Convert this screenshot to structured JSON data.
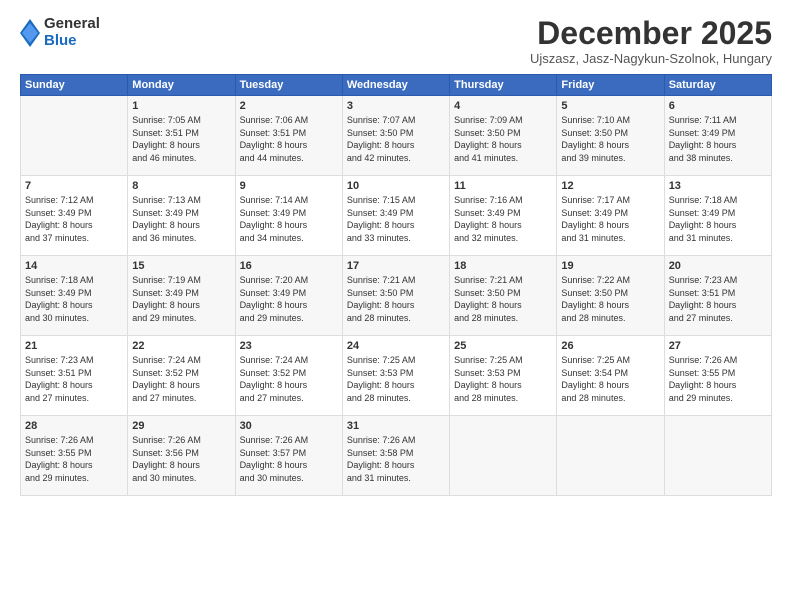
{
  "logo": {
    "general": "General",
    "blue": "Blue"
  },
  "title": "December 2025",
  "subtitle": "Ujszasz, Jasz-Nagykun-Szolnok, Hungary",
  "headers": [
    "Sunday",
    "Monday",
    "Tuesday",
    "Wednesday",
    "Thursday",
    "Friday",
    "Saturday"
  ],
  "weeks": [
    [
      {
        "day": "",
        "info": ""
      },
      {
        "day": "1",
        "info": "Sunrise: 7:05 AM\nSunset: 3:51 PM\nDaylight: 8 hours\nand 46 minutes."
      },
      {
        "day": "2",
        "info": "Sunrise: 7:06 AM\nSunset: 3:51 PM\nDaylight: 8 hours\nand 44 minutes."
      },
      {
        "day": "3",
        "info": "Sunrise: 7:07 AM\nSunset: 3:50 PM\nDaylight: 8 hours\nand 42 minutes."
      },
      {
        "day": "4",
        "info": "Sunrise: 7:09 AM\nSunset: 3:50 PM\nDaylight: 8 hours\nand 41 minutes."
      },
      {
        "day": "5",
        "info": "Sunrise: 7:10 AM\nSunset: 3:50 PM\nDaylight: 8 hours\nand 39 minutes."
      },
      {
        "day": "6",
        "info": "Sunrise: 7:11 AM\nSunset: 3:49 PM\nDaylight: 8 hours\nand 38 minutes."
      }
    ],
    [
      {
        "day": "7",
        "info": "Sunrise: 7:12 AM\nSunset: 3:49 PM\nDaylight: 8 hours\nand 37 minutes."
      },
      {
        "day": "8",
        "info": "Sunrise: 7:13 AM\nSunset: 3:49 PM\nDaylight: 8 hours\nand 36 minutes."
      },
      {
        "day": "9",
        "info": "Sunrise: 7:14 AM\nSunset: 3:49 PM\nDaylight: 8 hours\nand 34 minutes."
      },
      {
        "day": "10",
        "info": "Sunrise: 7:15 AM\nSunset: 3:49 PM\nDaylight: 8 hours\nand 33 minutes."
      },
      {
        "day": "11",
        "info": "Sunrise: 7:16 AM\nSunset: 3:49 PM\nDaylight: 8 hours\nand 32 minutes."
      },
      {
        "day": "12",
        "info": "Sunrise: 7:17 AM\nSunset: 3:49 PM\nDaylight: 8 hours\nand 31 minutes."
      },
      {
        "day": "13",
        "info": "Sunrise: 7:18 AM\nSunset: 3:49 PM\nDaylight: 8 hours\nand 31 minutes."
      }
    ],
    [
      {
        "day": "14",
        "info": "Sunrise: 7:18 AM\nSunset: 3:49 PM\nDaylight: 8 hours\nand 30 minutes."
      },
      {
        "day": "15",
        "info": "Sunrise: 7:19 AM\nSunset: 3:49 PM\nDaylight: 8 hours\nand 29 minutes."
      },
      {
        "day": "16",
        "info": "Sunrise: 7:20 AM\nSunset: 3:49 PM\nDaylight: 8 hours\nand 29 minutes."
      },
      {
        "day": "17",
        "info": "Sunrise: 7:21 AM\nSunset: 3:50 PM\nDaylight: 8 hours\nand 28 minutes."
      },
      {
        "day": "18",
        "info": "Sunrise: 7:21 AM\nSunset: 3:50 PM\nDaylight: 8 hours\nand 28 minutes."
      },
      {
        "day": "19",
        "info": "Sunrise: 7:22 AM\nSunset: 3:50 PM\nDaylight: 8 hours\nand 28 minutes."
      },
      {
        "day": "20",
        "info": "Sunrise: 7:23 AM\nSunset: 3:51 PM\nDaylight: 8 hours\nand 27 minutes."
      }
    ],
    [
      {
        "day": "21",
        "info": "Sunrise: 7:23 AM\nSunset: 3:51 PM\nDaylight: 8 hours\nand 27 minutes."
      },
      {
        "day": "22",
        "info": "Sunrise: 7:24 AM\nSunset: 3:52 PM\nDaylight: 8 hours\nand 27 minutes."
      },
      {
        "day": "23",
        "info": "Sunrise: 7:24 AM\nSunset: 3:52 PM\nDaylight: 8 hours\nand 27 minutes."
      },
      {
        "day": "24",
        "info": "Sunrise: 7:25 AM\nSunset: 3:53 PM\nDaylight: 8 hours\nand 28 minutes."
      },
      {
        "day": "25",
        "info": "Sunrise: 7:25 AM\nSunset: 3:53 PM\nDaylight: 8 hours\nand 28 minutes."
      },
      {
        "day": "26",
        "info": "Sunrise: 7:25 AM\nSunset: 3:54 PM\nDaylight: 8 hours\nand 28 minutes."
      },
      {
        "day": "27",
        "info": "Sunrise: 7:26 AM\nSunset: 3:55 PM\nDaylight: 8 hours\nand 29 minutes."
      }
    ],
    [
      {
        "day": "28",
        "info": "Sunrise: 7:26 AM\nSunset: 3:55 PM\nDaylight: 8 hours\nand 29 minutes."
      },
      {
        "day": "29",
        "info": "Sunrise: 7:26 AM\nSunset: 3:56 PM\nDaylight: 8 hours\nand 30 minutes."
      },
      {
        "day": "30",
        "info": "Sunrise: 7:26 AM\nSunset: 3:57 PM\nDaylight: 8 hours\nand 30 minutes."
      },
      {
        "day": "31",
        "info": "Sunrise: 7:26 AM\nSunset: 3:58 PM\nDaylight: 8 hours\nand 31 minutes."
      },
      {
        "day": "",
        "info": ""
      },
      {
        "day": "",
        "info": ""
      },
      {
        "day": "",
        "info": ""
      }
    ]
  ]
}
